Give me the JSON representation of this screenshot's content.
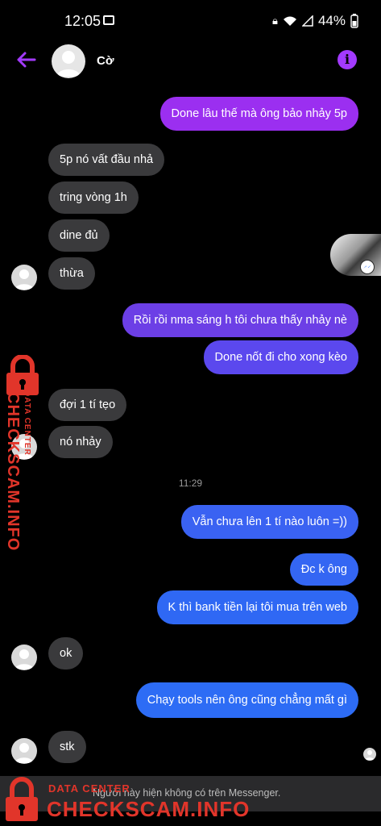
{
  "status_bar": {
    "time": "12:05",
    "battery": "44%"
  },
  "header": {
    "contact_name": "Cờ"
  },
  "colors": {
    "accent": "#a33aff",
    "out_top": "#9b2ff0",
    "out_bottom": "#2d6cf5",
    "in_bubble": "#3a3a3c"
  },
  "messages": [
    {
      "text": "Done lâu thế mà ông bảo nhảy 5p"
    },
    {
      "text": "5p nó vất đầu nhả"
    },
    {
      "text": "tring vòng 1h"
    },
    {
      "text": "dine đủ"
    },
    {
      "text": "thừa"
    },
    {
      "text": "Rồi rồi nma sáng h tôi chưa thấy nhảy nè"
    },
    {
      "text": "Done nốt đi cho xong kèo"
    },
    {
      "text": "đợi 1 tí tẹo"
    },
    {
      "text": "nó nhảy"
    },
    {
      "text": "Vẫn chưa lên 1 tí nào luôn =))"
    },
    {
      "text": "Đc k ông"
    },
    {
      "text": "K thì bank tiền lại tôi mua trên web"
    },
    {
      "text": "ok"
    },
    {
      "text": "Chạy tools nên ông cũng chẳng mất gì"
    },
    {
      "text": "stk"
    }
  ],
  "timestamp": "11:29",
  "footer": {
    "notice": "Người này hiện không có trên Messenger."
  },
  "watermark": {
    "top": "DATA CENTER",
    "main": "CHECKSCAM.INFO"
  }
}
